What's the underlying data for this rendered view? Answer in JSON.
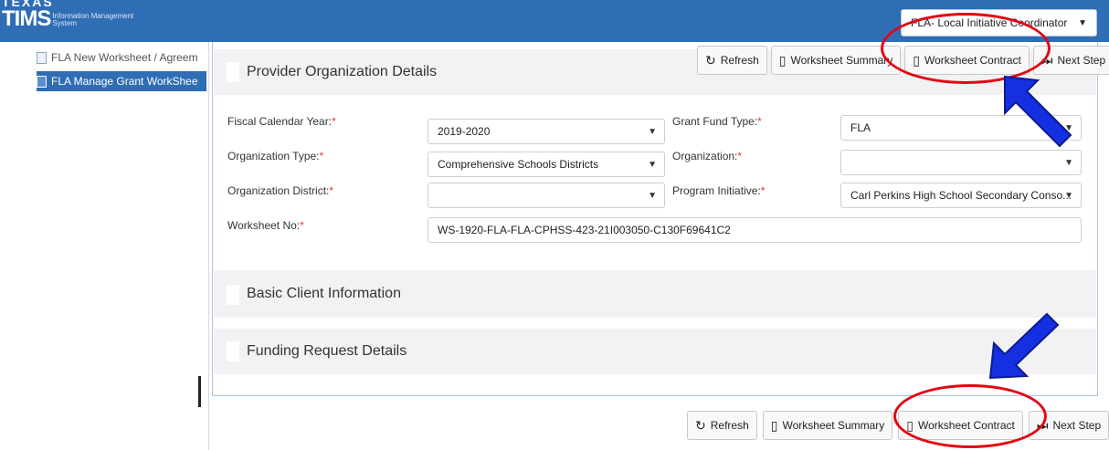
{
  "app": {
    "logo_text": "TIMS",
    "logo_sub_line1": "Information Management",
    "logo_sub_line2": "System",
    "logo_cut_text": "TEXAS"
  },
  "header": {
    "role_value": "FLA- Local Initiative Coordinator"
  },
  "sidebar": {
    "items": [
      {
        "label": "FLA New Worksheet / Agreem"
      },
      {
        "label": "FLA Manage Grant WorkShee"
      }
    ]
  },
  "toolbar": {
    "refresh": "Refresh",
    "summary": "Worksheet Summary",
    "contract": "Worksheet Contract",
    "next": "Next Step"
  },
  "sections": {
    "provider": "Provider Organization Details",
    "client": "Basic Client Information",
    "funding": "Funding Request Details"
  },
  "form": {
    "fiscal_year_label": "Fiscal Calendar Year:",
    "fiscal_year_value": "2019-2020",
    "grant_fund_label": "Grant Fund Type:",
    "grant_fund_value": "FLA",
    "org_type_label": "Organization Type:",
    "org_type_value": "Comprehensive Schools Districts",
    "organization_label": "Organization:",
    "organization_value": "",
    "org_district_label": "Organization District:",
    "org_district_value": "",
    "program_label": "Program Initiative:",
    "program_value": "Carl Perkins High School Secondary Conso...",
    "worksheet_label": "Worksheet No:",
    "worksheet_value": "WS-1920-FLA-FLA-CPHSS-423-21I003050-C130F69641C2",
    "required_mark": "*"
  },
  "colors": {
    "header_blue": "#2f6db5",
    "annotation_red": "#e30613",
    "annotation_arrow": "#1530e0"
  }
}
